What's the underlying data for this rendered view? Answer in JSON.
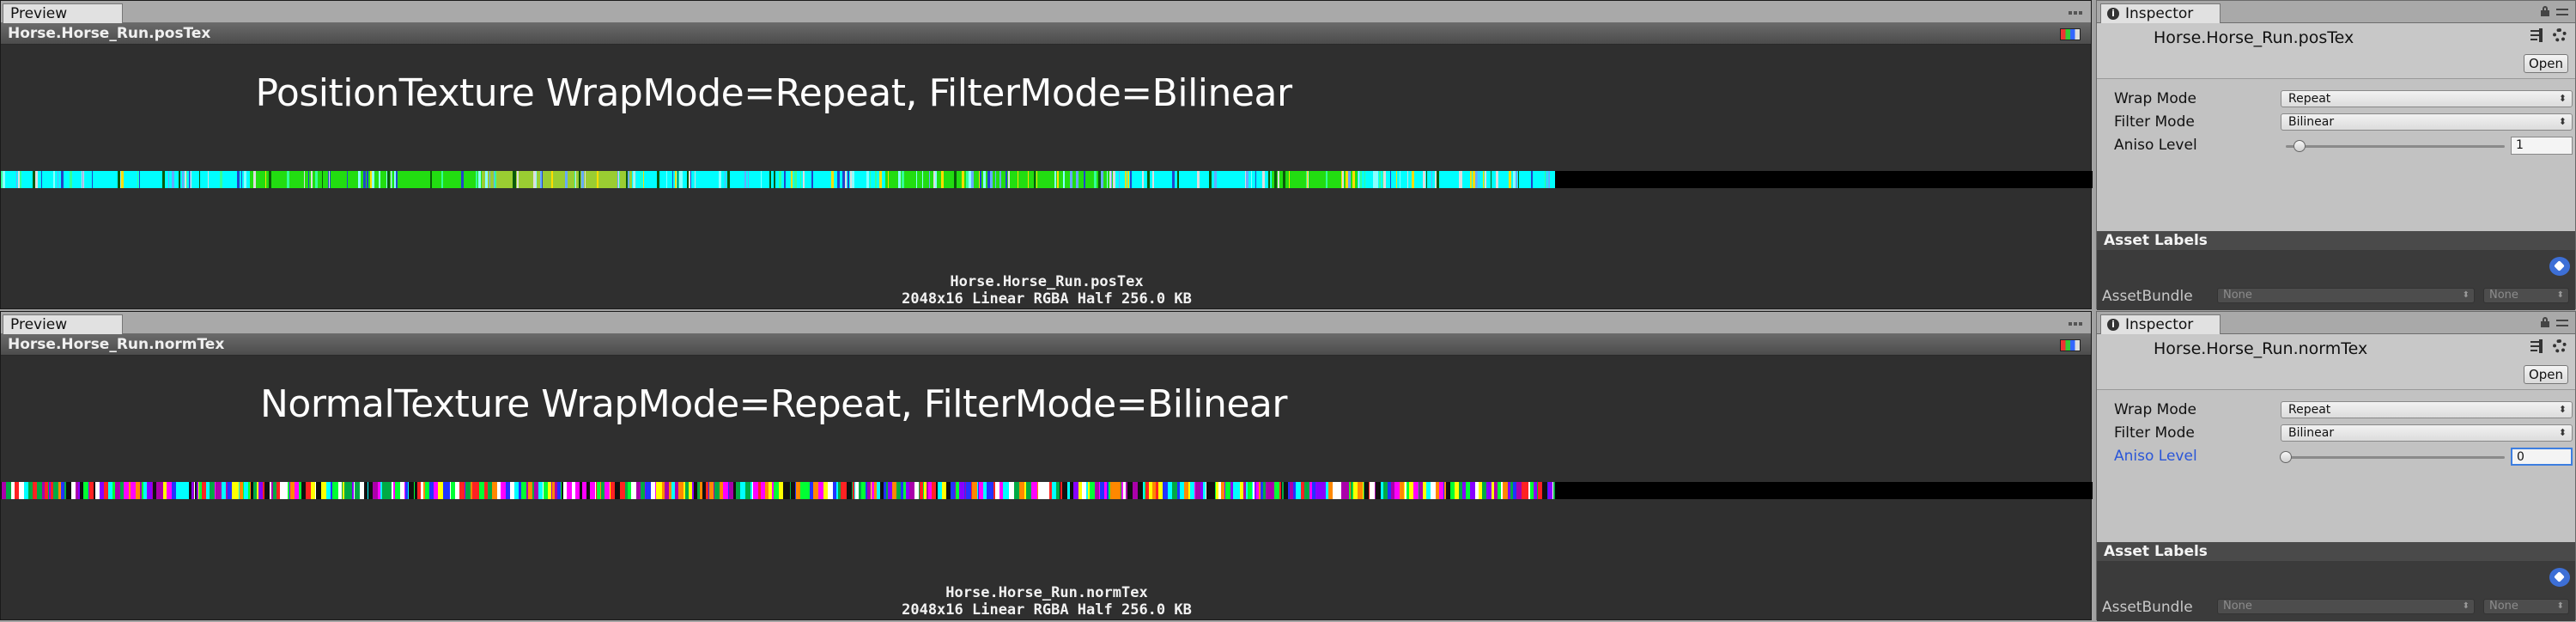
{
  "panels": [
    {
      "preview": {
        "tab_label": "Preview",
        "asset_title": "Horse.Horse_Run.posTex",
        "caption": "PositionTexture WrapMode=Repeat, FilterMode=Bilinear",
        "info_name": "Horse.Horse_Run.posTex",
        "info_details": "2048x16 Linear  RGBA Half   256.0 KB"
      },
      "inspector": {
        "tab_label": "Inspector",
        "asset_name": "Horse.Horse_Run.posTex",
        "open_label": "Open",
        "wrap_mode_label": "Wrap Mode",
        "wrap_mode_value": "Repeat",
        "filter_mode_label": "Filter Mode",
        "filter_mode_value": "Bilinear",
        "aniso_label": "Aniso Level",
        "aniso_value": "1",
        "aniso_level": 1,
        "asset_labels_title": "Asset Labels",
        "asset_bundle_label": "AssetBundle",
        "asset_bundle_value": "None",
        "asset_bundle_variant": "None"
      }
    },
    {
      "preview": {
        "tab_label": "Preview",
        "asset_title": "Horse.Horse_Run.normTex",
        "caption": "NormalTexture WrapMode=Repeat, FilterMode=Bilinear",
        "info_name": "Horse.Horse_Run.normTex",
        "info_details": "2048x16 Linear  RGBA Half   256.0 KB"
      },
      "inspector": {
        "tab_label": "Inspector",
        "asset_name": "Horse.Horse_Run.normTex",
        "open_label": "Open",
        "wrap_mode_label": "Wrap Mode",
        "wrap_mode_value": "Repeat",
        "filter_mode_label": "Filter Mode",
        "filter_mode_value": "Bilinear",
        "aniso_label": "Aniso Level",
        "aniso_value": "0",
        "aniso_level": 0,
        "asset_labels_title": "Asset Labels",
        "asset_bundle_label": "AssetBundle",
        "asset_bundle_value": "None",
        "asset_bundle_variant": "None"
      }
    }
  ],
  "colors": {
    "preview_bg": "#2f2f2f",
    "inspector_bg": "#c2c2c2",
    "focus_blue": "#3d7ee0",
    "cyan": "#00ffff",
    "green": "#22dd11",
    "tag_blue": "#3d6fd6"
  },
  "icons": [
    "info-icon",
    "lock-icon",
    "menu-icon",
    "gear-icon",
    "tag-icon",
    "rgba-channels-icon"
  ]
}
